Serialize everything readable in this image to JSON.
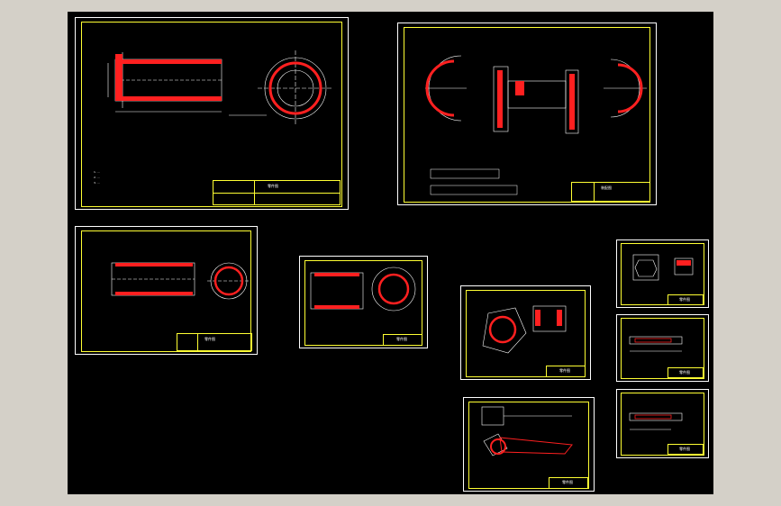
{
  "viewer": {
    "background_color": "#000000",
    "frame_color": "#ffff33",
    "hatch_color": "#ff2020",
    "line_color": "#ffffff"
  },
  "sheets": [
    {
      "id": "sheet-1",
      "title_text": "零件图",
      "notes": [
        "1. ...",
        "2. ...",
        "3. ..."
      ]
    },
    {
      "id": "sheet-2",
      "title_text": "装配图"
    },
    {
      "id": "sheet-3",
      "title_text": "零件图"
    },
    {
      "id": "sheet-4",
      "title_text": "零件图"
    },
    {
      "id": "sheet-5",
      "title_text": "零件图"
    },
    {
      "id": "sheet-6",
      "title_text": "零件图"
    },
    {
      "id": "sheet-7",
      "title_text": "零件图"
    },
    {
      "id": "sheet-8",
      "title_text": "零件图"
    },
    {
      "id": "sheet-9",
      "title_text": "零件图"
    }
  ]
}
